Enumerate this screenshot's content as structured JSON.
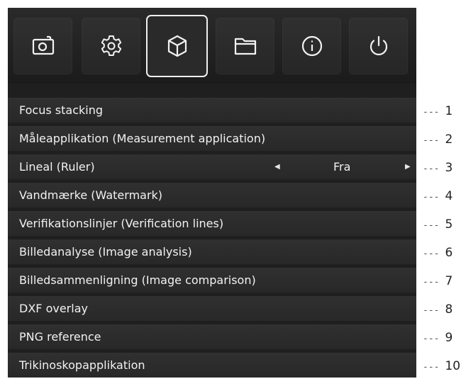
{
  "toolbar": {
    "buttons": [
      {
        "icon": "camera-icon",
        "active": false
      },
      {
        "icon": "gear-icon",
        "active": false
      },
      {
        "icon": "cube-icon",
        "active": true
      },
      {
        "icon": "folder-icon",
        "active": false
      },
      {
        "icon": "info-icon",
        "active": false
      },
      {
        "icon": "power-icon",
        "active": false
      }
    ]
  },
  "menu": {
    "items": [
      {
        "label": "Focus stacking"
      },
      {
        "label": "Måleapplikation (Measurement application)"
      },
      {
        "label": "Lineal (Ruler)",
        "value": "Fra"
      },
      {
        "label": "Vandmærke (Watermark)"
      },
      {
        "label": "Verifikationslinjer (Verification lines)"
      },
      {
        "label": "Billedanalyse (Image analysis)"
      },
      {
        "label": "Billedsammenligning (Image comparison)"
      },
      {
        "label": "DXF overlay"
      },
      {
        "label": "PNG reference"
      },
      {
        "label": "Trikinoskopapplikation"
      }
    ]
  },
  "callouts": {
    "dash": "---",
    "numbers": [
      "1",
      "2",
      "3",
      "4",
      "5",
      "6",
      "7",
      "8",
      "9",
      "10"
    ]
  },
  "colors": {
    "background": "#1f1f1f",
    "row": "#2c2c2c",
    "text": "#f2f2f2",
    "active_border": "#f0f0f0"
  }
}
